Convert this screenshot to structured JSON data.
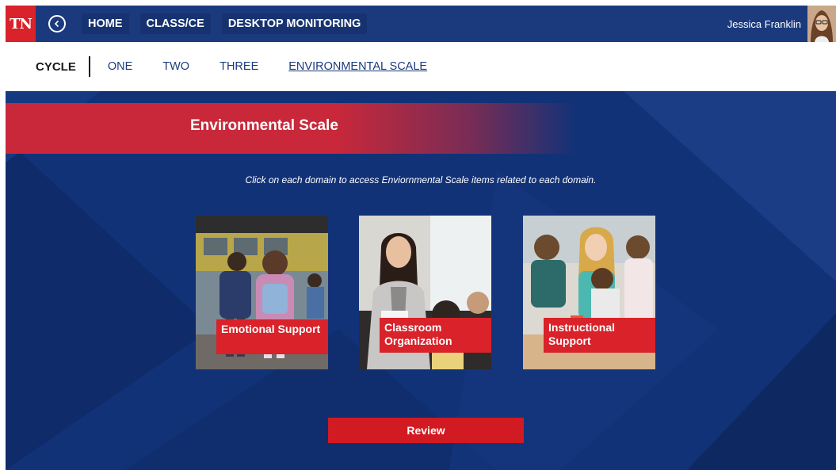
{
  "header": {
    "logo_text": "TN",
    "nav": [
      {
        "label": "HOME"
      },
      {
        "label": "CLASS/CE"
      },
      {
        "label": "DESKTOP MONITORING"
      }
    ],
    "user_name": "Jessica Franklin",
    "icons": {
      "back": "back-circle-icon",
      "avatar": "user-avatar"
    }
  },
  "cycle_bar": {
    "label": "CYCLE",
    "tabs": [
      {
        "label": "ONE"
      },
      {
        "label": "TWO"
      },
      {
        "label": "THREE"
      },
      {
        "label": "ENVIRONMENTAL SCALE",
        "active": true
      }
    ]
  },
  "main": {
    "title": "Environmental Scale",
    "instruction": "Click on each domain to access Enviornmental Scale items related to each domain.",
    "domains": [
      {
        "label": "Emotional Support"
      },
      {
        "label": "Classroom Organization"
      },
      {
        "label": "Instructional Support"
      }
    ],
    "review_label": "Review"
  },
  "colors": {
    "nav_blue": "#1b3a7e",
    "main_blue": "#123278",
    "accent_red": "#d9222a",
    "link_blue": "#1b3a7e"
  }
}
